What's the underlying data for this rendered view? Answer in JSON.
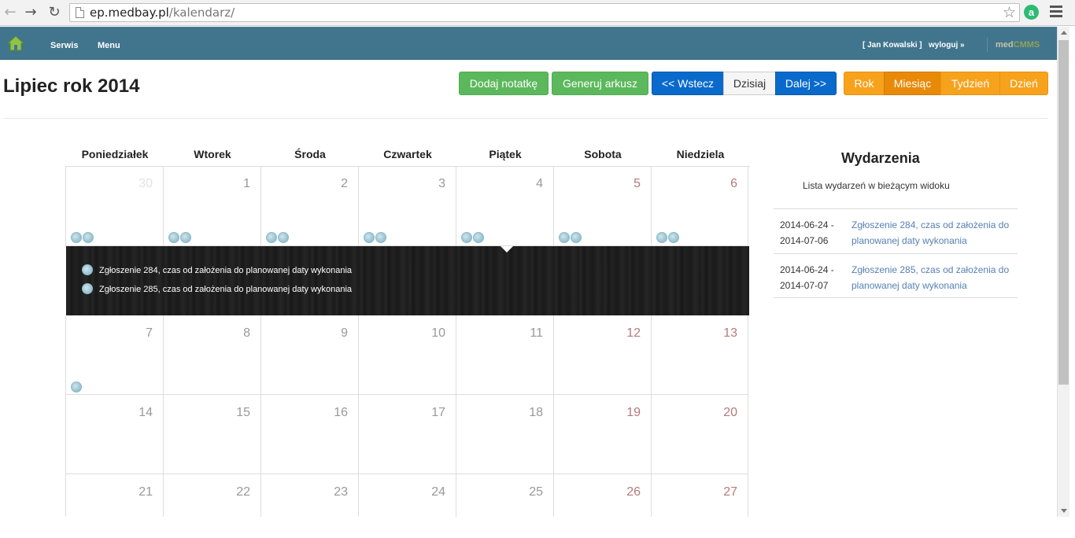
{
  "browser": {
    "url_host": "ep.medbay.pl",
    "url_path": "/kalendarz/",
    "back_glyph": "←",
    "forward_glyph": "→",
    "reload_glyph": "↻",
    "star_glyph": "☆",
    "extension_letter": "a"
  },
  "header": {
    "nav": [
      "Serwis",
      "Menu"
    ],
    "user": "[ Jan Kowalski ]",
    "logout": "wyloguj »",
    "brand_a": "med",
    "brand_b": "CMMS"
  },
  "page": {
    "title": "Lipiec rok 2014"
  },
  "toolbar": {
    "add_note": "Dodaj notatkę",
    "generate": "Generuj arkusz",
    "back": "<< Wstecz",
    "today": "Dzisiaj",
    "next": "Dalej >>",
    "views": [
      "Rok",
      "Miesiąc",
      "Tydzień",
      "Dzień"
    ],
    "active_view": "Miesiąc"
  },
  "calendar": {
    "weekdays": [
      "Poniedziałek",
      "Wtorek",
      "Środa",
      "Czwartek",
      "Piątek",
      "Sobota",
      "Niedziela"
    ],
    "weeks": [
      [
        "30",
        "1",
        "2",
        "3",
        "4",
        "5",
        "6"
      ],
      [
        "7",
        "8",
        "9",
        "10",
        "11",
        "12",
        "13"
      ],
      [
        "14",
        "15",
        "16",
        "17",
        "18",
        "19",
        "20"
      ],
      [
        "21",
        "22",
        "23",
        "24",
        "25",
        "26",
        "27"
      ]
    ],
    "expanded_events": [
      "Zgłoszenie 284, czas od założenia do planowanej daty wykonania",
      "Zgłoszenie 285, czas od założenia do planowanej daty wykonania"
    ],
    "colors": {
      "weekend_number": "#b57a7a",
      "event_dot": "#a9cdd9"
    }
  },
  "sidebar": {
    "title": "Wydarzenia",
    "subtitle": "Lista wydarzeń w bieżącym widoku",
    "events": [
      {
        "start": "2014-06-24 -",
        "end": "2014-07-06",
        "label": "Zgłoszenie 284, czas od założenia do planowanej daty wykonania"
      },
      {
        "start": "2014-06-24 -",
        "end": "2014-07-07",
        "label": "Zgłoszenie 285, czas od założenia do planowanej daty wykonania"
      }
    ]
  }
}
